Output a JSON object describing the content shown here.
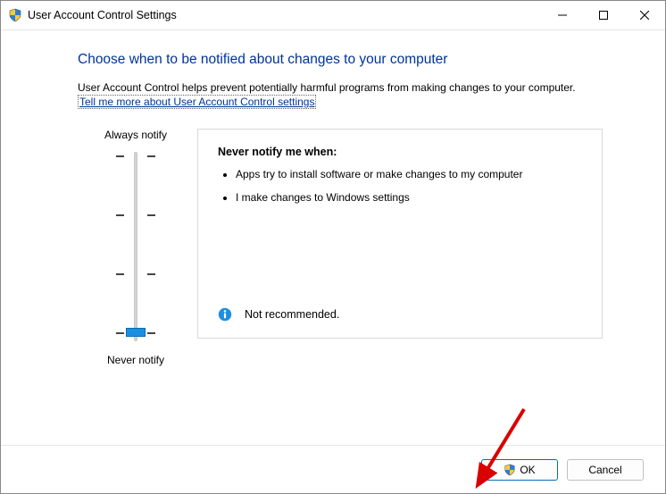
{
  "titlebar": {
    "title": "User Account Control Settings"
  },
  "content": {
    "heading": "Choose when to be notified about changes to your computer",
    "description": "User Account Control helps prevent potentially harmful programs from making changes to your computer.",
    "link": "Tell me more about User Account Control settings"
  },
  "slider": {
    "top_label": "Always notify",
    "bottom_label": "Never notify",
    "value_index": 3,
    "levels": 4
  },
  "panel": {
    "heading": "Never notify me when:",
    "items": [
      "Apps try to install software or make changes to my computer",
      "I make changes to Windows settings"
    ],
    "recommendation": "Not recommended."
  },
  "footer": {
    "ok": "OK",
    "cancel": "Cancel"
  }
}
